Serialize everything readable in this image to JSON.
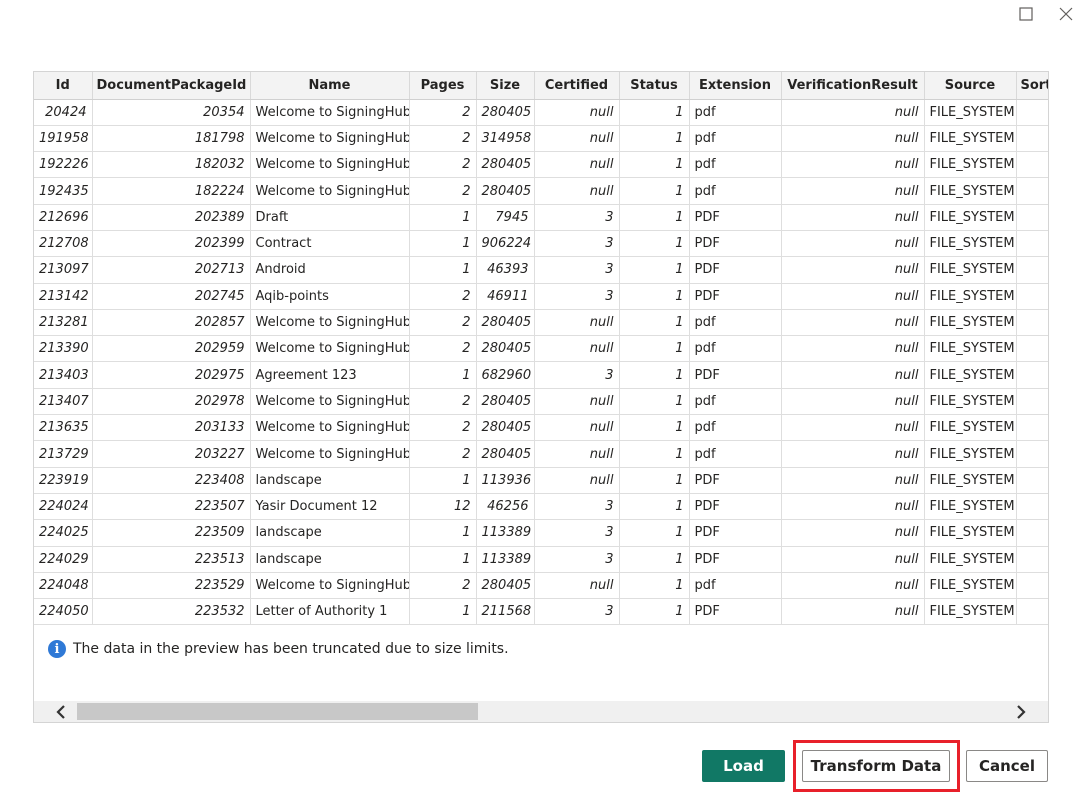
{
  "window": {
    "maximize_icon": "maximize-icon",
    "close_icon": "close-icon"
  },
  "table": {
    "columns": [
      "Id",
      "DocumentPackageId",
      "Name",
      "Pages",
      "Size",
      "Certified",
      "Status",
      "Extension",
      "VerificationResult",
      "Source",
      "Sort"
    ],
    "rows": [
      [
        "20424",
        "20354",
        "Welcome to SigningHub",
        "2",
        "280405",
        "null",
        "1",
        "pdf",
        "null",
        "FILE_SYSTEM"
      ],
      [
        "191958",
        "181798",
        "Welcome to SigningHub",
        "2",
        "314958",
        "null",
        "1",
        "pdf",
        "null",
        "FILE_SYSTEM"
      ],
      [
        "192226",
        "182032",
        "Welcome to SigningHub",
        "2",
        "280405",
        "null",
        "1",
        "pdf",
        "null",
        "FILE_SYSTEM"
      ],
      [
        "192435",
        "182224",
        "Welcome to SigningHub",
        "2",
        "280405",
        "null",
        "1",
        "pdf",
        "null",
        "FILE_SYSTEM"
      ],
      [
        "212696",
        "202389",
        "Draft",
        "1",
        "7945",
        "3",
        "1",
        "PDF",
        "null",
        "FILE_SYSTEM"
      ],
      [
        "212708",
        "202399",
        "Contract",
        "1",
        "906224",
        "3",
        "1",
        "PDF",
        "null",
        "FILE_SYSTEM"
      ],
      [
        "213097",
        "202713",
        "Android",
        "1",
        "46393",
        "3",
        "1",
        "PDF",
        "null",
        "FILE_SYSTEM"
      ],
      [
        "213142",
        "202745",
        "Aqib-points",
        "2",
        "46911",
        "3",
        "1",
        "PDF",
        "null",
        "FILE_SYSTEM"
      ],
      [
        "213281",
        "202857",
        "Welcome to SigningHub",
        "2",
        "280405",
        "null",
        "1",
        "pdf",
        "null",
        "FILE_SYSTEM"
      ],
      [
        "213390",
        "202959",
        "Welcome to SigningHub",
        "2",
        "280405",
        "null",
        "1",
        "pdf",
        "null",
        "FILE_SYSTEM"
      ],
      [
        "213403",
        "202975",
        "Agreement 123",
        "1",
        "682960",
        "3",
        "1",
        "PDF",
        "null",
        "FILE_SYSTEM"
      ],
      [
        "213407",
        "202978",
        "Welcome to SigningHub",
        "2",
        "280405",
        "null",
        "1",
        "pdf",
        "null",
        "FILE_SYSTEM"
      ],
      [
        "213635",
        "203133",
        "Welcome to SigningHub",
        "2",
        "280405",
        "null",
        "1",
        "pdf",
        "null",
        "FILE_SYSTEM"
      ],
      [
        "213729",
        "203227",
        "Welcome to SigningHub",
        "2",
        "280405",
        "null",
        "1",
        "pdf",
        "null",
        "FILE_SYSTEM"
      ],
      [
        "223919",
        "223408",
        "landscape",
        "1",
        "113936",
        "null",
        "1",
        "PDF",
        "null",
        "FILE_SYSTEM"
      ],
      [
        "224024",
        "223507",
        "Yasir Document 12",
        "12",
        "46256",
        "3",
        "1",
        "PDF",
        "null",
        "FILE_SYSTEM"
      ],
      [
        "224025",
        "223509",
        "landscape",
        "1",
        "113389",
        "3",
        "1",
        "PDF",
        "null",
        "FILE_SYSTEM"
      ],
      [
        "224029",
        "223513",
        "landscape",
        "1",
        "113389",
        "3",
        "1",
        "PDF",
        "null",
        "FILE_SYSTEM"
      ],
      [
        "224048",
        "223529",
        "Welcome to SigningHub",
        "2",
        "280405",
        "null",
        "1",
        "pdf",
        "null",
        "FILE_SYSTEM"
      ],
      [
        "224050",
        "223532",
        "Letter of Authority 1",
        "1",
        "211568",
        "3",
        "1",
        "PDF",
        "null",
        "FILE_SYSTEM"
      ]
    ]
  },
  "info": {
    "icon": "info-icon",
    "message": "The data in the preview has been truncated due to size limits."
  },
  "scrollbar": {
    "left_icon": "chevron-left-icon",
    "right_icon": "chevron-right-icon"
  },
  "buttons": {
    "load": "Load",
    "transform": "Transform Data",
    "cancel": "Cancel"
  },
  "colors": {
    "load_bg": "#117865",
    "highlight": "#e8202a",
    "info_icon": "#2f79d6"
  }
}
